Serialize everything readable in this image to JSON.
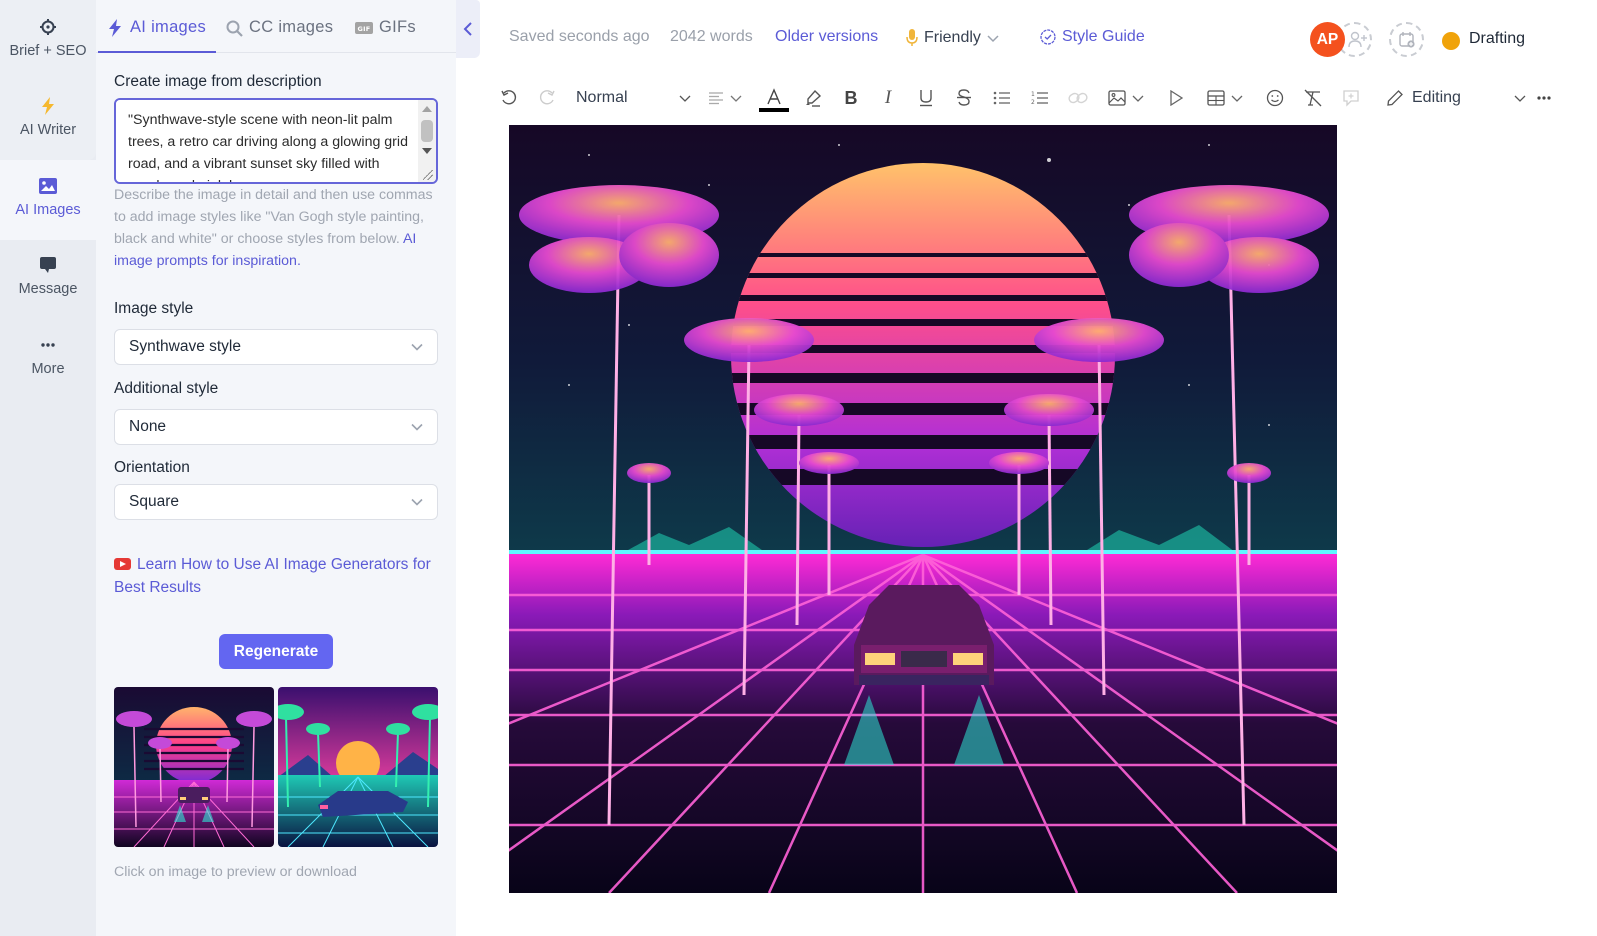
{
  "rail": {
    "items": [
      {
        "label": "Brief + SEO",
        "icon": "crosshair-icon"
      },
      {
        "label": "AI Writer",
        "icon": "lightning-icon"
      },
      {
        "label": "AI Images",
        "icon": "image-icon",
        "active": true
      },
      {
        "label": "Message",
        "icon": "message-icon"
      },
      {
        "label": "More",
        "icon": "more-dots-icon"
      }
    ]
  },
  "panel": {
    "tabs": [
      {
        "label": "AI images",
        "icon": "lightning-icon",
        "active": true
      },
      {
        "label": "CC images",
        "icon": "search-icon"
      },
      {
        "label": "GIFs",
        "icon": "gif-icon"
      }
    ],
    "prompt_label": "Create image from description",
    "prompt_value": "\"Synthwave-style scene with neon-lit palm trees, a retro car driving along a glowing grid road, and a vibrant sunset sky filled with purple and pink hues.",
    "help_text": "Describe the image in detail and then use commas to add image styles like \"Van Gogh style painting, black and white\" or choose styles from below.",
    "help_link": "AI image prompts for inspiration.",
    "image_style_label": "Image style",
    "image_style_value": "Synthwave style",
    "additional_style_label": "Additional style",
    "additional_style_value": "None",
    "orientation_label": "Orientation",
    "orientation_value": "Square",
    "learn_link": "Learn How to Use AI Image Generators for Best Results",
    "regenerate_label": "Regenerate",
    "hint": "Click on image to preview or download",
    "thumbnails": [
      {
        "description": "Synthwave sunset with pink palm trees and retro car on neon grid"
      },
      {
        "description": "Synthwave scene with teal palm trees, mountains and retro car on cyan grid"
      }
    ]
  },
  "header": {
    "saved": "Saved seconds ago",
    "words": "2042 words",
    "older_versions": "Older versions",
    "tone": "Friendly",
    "style_guide": "Style Guide",
    "avatar_initials": "AP",
    "status": "Drafting",
    "status_color": "#f0a30a"
  },
  "toolbar": {
    "block_style": "Normal",
    "mode": "Editing"
  },
  "document": {
    "image_description": "Synthwave-style scene with neon palm trees, striped sunset, and retro car on glowing grid road"
  },
  "colors": {
    "accent": "#5b5bd6",
    "button": "#6366f1",
    "avatar": "#f4511e"
  }
}
